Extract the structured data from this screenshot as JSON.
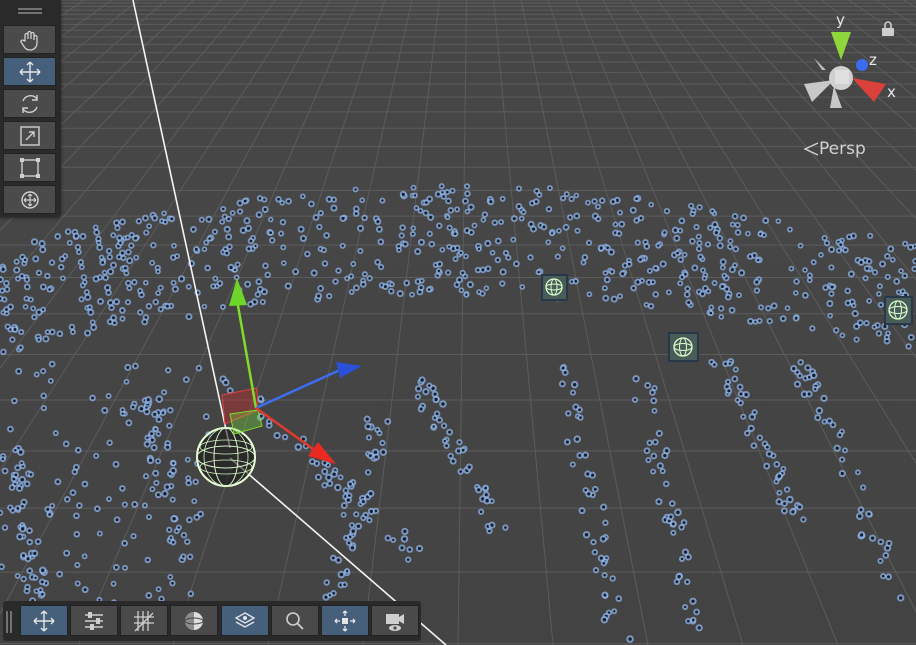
{
  "view": {
    "projection_label": "Persp",
    "axis_labels": {
      "x": "x",
      "y": "y",
      "z": "z"
    },
    "colors": {
      "x_axis": "#e03a2f",
      "y_axis": "#7fdc2a",
      "z_axis": "#3d7bf2",
      "particle": "#8fb3e8",
      "grid": "#5c5c5c",
      "active_tool": "#46607c"
    }
  },
  "tools": [
    {
      "name": "hand-tool",
      "icon": "hand-icon",
      "active": false
    },
    {
      "name": "move-tool",
      "icon": "move-icon",
      "active": true
    },
    {
      "name": "rotate-tool",
      "icon": "rotate-icon",
      "active": false
    },
    {
      "name": "scale-tool",
      "icon": "scale-icon",
      "active": false
    },
    {
      "name": "rect-tool",
      "icon": "rect-icon",
      "active": false
    },
    {
      "name": "transform-tool",
      "icon": "transform-icon",
      "active": false
    }
  ],
  "overlay_toolbar": [
    {
      "name": "move-overlay",
      "icon": "move-arrows-icon",
      "active": true
    },
    {
      "name": "settings-overlay",
      "icon": "sliders-icon",
      "active": false
    },
    {
      "name": "grid-overlay",
      "icon": "grid-snap-icon",
      "active": false
    },
    {
      "name": "shading-overlay",
      "icon": "sphere-shading-icon",
      "active": false
    },
    {
      "name": "layers-overlay",
      "icon": "layers-icon",
      "active": true
    },
    {
      "name": "search-overlay",
      "icon": "search-icon",
      "active": false
    },
    {
      "name": "focus-overlay",
      "icon": "focus-icon",
      "active": true
    },
    {
      "name": "camera-overlay",
      "icon": "camera-icon",
      "active": false
    }
  ]
}
